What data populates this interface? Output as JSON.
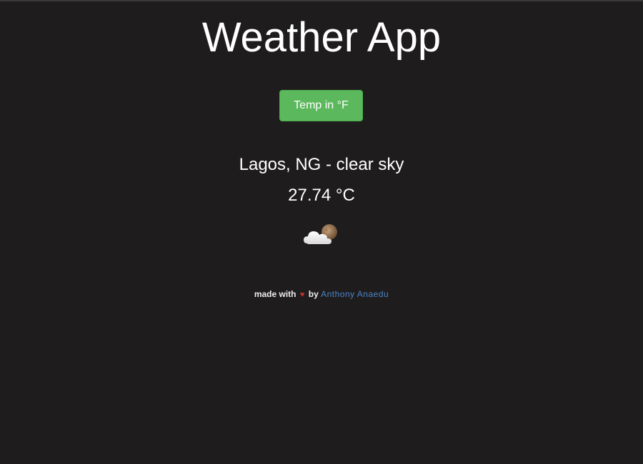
{
  "header": {
    "title": "Weather App"
  },
  "toggle": {
    "label": "Temp in °F"
  },
  "weather": {
    "location_description": "Lagos, NG - clear sky",
    "temperature": "27.74 °C",
    "icon": "cloud-moon-icon"
  },
  "footer": {
    "made_with": "made with",
    "heart": "♥",
    "by": "by",
    "author": "Anthony Anaedu"
  },
  "colors": {
    "background": "#1e1c1d",
    "button": "#5cb85c",
    "heart": "#c9302c",
    "link": "#4a86c8"
  }
}
